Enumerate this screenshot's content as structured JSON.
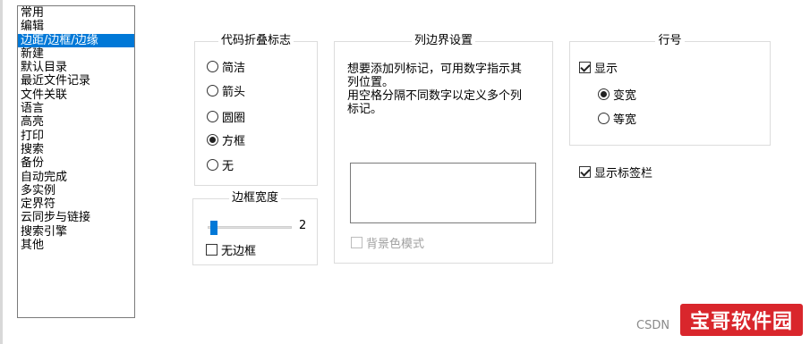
{
  "categories": [
    "常用",
    "编辑",
    "边距/边框/边缘",
    "新建",
    "默认目录",
    "最近文件记录",
    "文件关联",
    "语言",
    "高亮",
    "打印",
    "搜索",
    "备份",
    "自动完成",
    "多实例",
    "定界符",
    "云同步与链接",
    "搜索引擎",
    "其他"
  ],
  "selected_category": "边距/边框/边缘",
  "fold_marker": {
    "title": "代码折叠标志",
    "options": [
      "简洁",
      "箭头",
      "圆圈",
      "方框",
      "无"
    ],
    "selected": "方框"
  },
  "border_width": {
    "title": "边框宽度",
    "value": "2",
    "no_border_label": "无边框",
    "no_border_checked": false
  },
  "column_edge": {
    "title": "列边界设置",
    "hint_lines": [
      "想要添加列标记，可用数字指示其",
      "列位置。",
      "用空格分隔不同数字以定义多个列",
      "标记。"
    ],
    "input_value": "",
    "bg_mode_label": "背景色模式",
    "bg_mode_enabled": false
  },
  "line_number": {
    "title": "行号",
    "show_label": "显示",
    "show_checked": true,
    "width_options": [
      "变宽",
      "等宽"
    ],
    "width_selected": "变宽"
  },
  "show_tab_bar": {
    "label": "显示标签栏",
    "checked": true
  },
  "watermark": {
    "csdn": "CSDN",
    "logo": "宝哥软件园"
  }
}
